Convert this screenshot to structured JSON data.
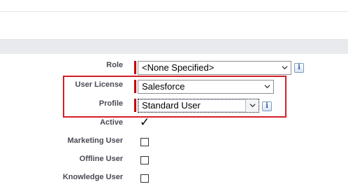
{
  "form": {
    "role": {
      "label": "Role",
      "value": "<None Specified>",
      "info": "i"
    },
    "user_license": {
      "label": "User License",
      "value": "Salesforce"
    },
    "profile": {
      "label": "Profile",
      "value": "Standard User",
      "info": "i"
    },
    "active": {
      "label": "Active",
      "checked": true,
      "mark": "✓"
    },
    "marketing_user": {
      "label": "Marketing User",
      "checked": false
    },
    "offline_user": {
      "label": "Offline User",
      "checked": false
    },
    "knowledge_user": {
      "label": "Knowledge User",
      "checked": false
    }
  },
  "colors": {
    "required": "#c00000",
    "highlight": "#d21f2b",
    "section_band": "#e8eaee"
  }
}
